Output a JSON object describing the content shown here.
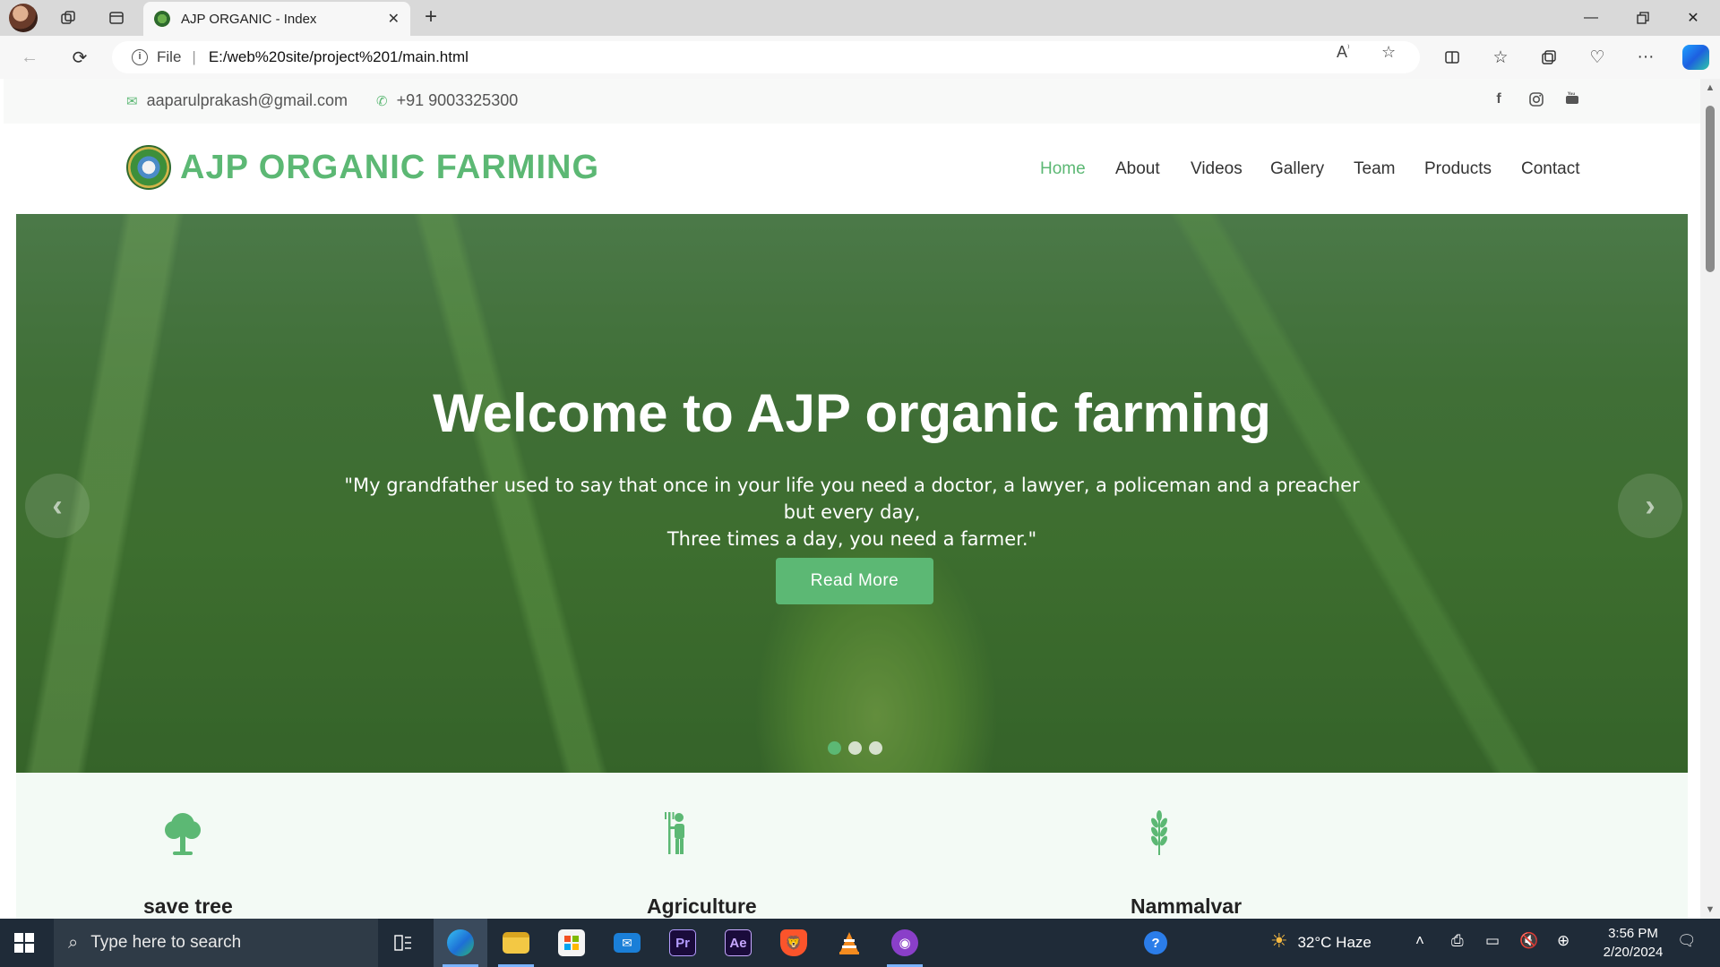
{
  "browser": {
    "tab_title": "AJP ORGANIC - Index",
    "url_scheme_label": "File",
    "url": "E:/web%20site/project%201/main.html"
  },
  "site": {
    "topbar": {
      "email": "aaparulprakash@gmail.com",
      "phone": "+91 9003325300"
    },
    "brand": "AJP ORGANIC FARMING",
    "nav": [
      {
        "label": "Home",
        "active": true
      },
      {
        "label": "About"
      },
      {
        "label": "Videos"
      },
      {
        "label": "Gallery"
      },
      {
        "label": "Team"
      },
      {
        "label": "Products"
      },
      {
        "label": "Contact"
      }
    ],
    "hero": {
      "title": "Welcome to AJP organic farming",
      "quote_line1": "\"My grandfather used to say that once in your life you need a doctor, a lawyer, a policeman and a preacher but every day,",
      "quote_line2": "Three times a day, you need a farmer.\"",
      "button": "Read More",
      "slide_count": 3,
      "active_slide": 1
    },
    "features": [
      {
        "title": "save tree",
        "icon": "tree-icon"
      },
      {
        "title": "Agriculture",
        "icon": "farmer-icon"
      },
      {
        "title": "Nammalvar",
        "icon": "wheat-icon"
      }
    ],
    "accent_color": "#5cb874"
  },
  "taskbar": {
    "search_placeholder": "Type here to search",
    "weather": "32°C  Haze",
    "time": "3:56 PM",
    "date": "2/20/2024"
  }
}
